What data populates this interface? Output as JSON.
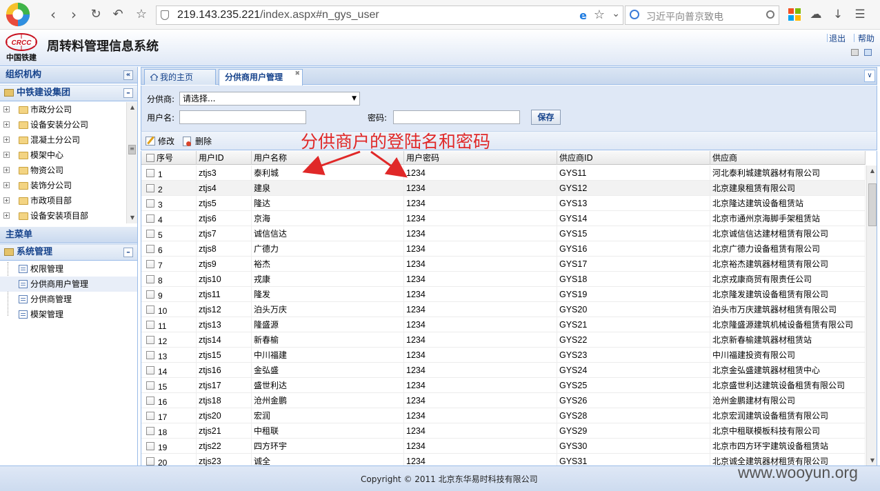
{
  "browser": {
    "url_host": "219.143.235.221",
    "url_path": "/index.aspx#n_gys_user",
    "search_placeholder": "习近平向普京致电"
  },
  "app": {
    "title": "周转料管理信息系统",
    "logo_text": "中国铁建",
    "logo_mark": "CRCC",
    "links": {
      "logout": "退出",
      "help": "帮助"
    }
  },
  "left": {
    "org_title": "组织机构",
    "org_group": "中铁建设集团",
    "org_items": [
      "市政分公司",
      "设备安装分公司",
      "混凝土分公司",
      "模架中心",
      "物资公司",
      "装饰分公司",
      "市政项目部",
      "设备安装项目部"
    ],
    "menu_title": "主菜单",
    "menu_group": "系统管理",
    "menu_items": [
      "权限管理",
      "分供商用户管理",
      "分供商管理",
      "模架管理"
    ]
  },
  "tabs": [
    "我的主页",
    "分供商用户管理"
  ],
  "form": {
    "supplier_label": "分供商:",
    "supplier_value": "请选择...",
    "username_label": "用户名:",
    "password_label": "密码:",
    "save_label": "保存"
  },
  "toolbar": {
    "edit_label": "修改",
    "delete_label": "删除"
  },
  "grid": {
    "columns": [
      "序号",
      "用户ID",
      "用户名称",
      "用户密码",
      "供应商ID",
      "供应商"
    ],
    "rows": [
      [
        "1",
        "ztjs3",
        "泰利城",
        "1234",
        "GYS11",
        "河北泰利城建筑器材有限公司"
      ],
      [
        "2",
        "ztjs4",
        "建泉",
        "1234",
        "GYS12",
        "北京建泉租赁有限公司"
      ],
      [
        "3",
        "ztjs5",
        "隆达",
        "1234",
        "GYS13",
        "北京隆达建筑设备租赁站"
      ],
      [
        "4",
        "ztjs6",
        "京海",
        "1234",
        "GYS14",
        "北京市通州京海脚手架租赁站"
      ],
      [
        "5",
        "ztjs7",
        "诚信信达",
        "1234",
        "GYS15",
        "北京诚信信达建材租赁有限公司"
      ],
      [
        "6",
        "ztjs8",
        "广德力",
        "1234",
        "GYS16",
        "北京广德力设备租赁有限公司"
      ],
      [
        "7",
        "ztjs9",
        "裕杰",
        "1234",
        "GYS17",
        "北京裕杰建筑器材租赁有限公司"
      ],
      [
        "8",
        "ztjs10",
        "戎康",
        "1234",
        "GYS18",
        "北京戎康商贸有限责任公司"
      ],
      [
        "9",
        "ztjs11",
        "隆发",
        "1234",
        "GYS19",
        "北京隆发建筑设备租赁有限公司"
      ],
      [
        "10",
        "ztjs12",
        "泊头万庆",
        "1234",
        "GYS20",
        "泊头市万庆建筑器材租赁有限公司"
      ],
      [
        "11",
        "ztjs13",
        "隆盛源",
        "1234",
        "GYS21",
        "北京隆盛源建筑机械设备租赁有限公司"
      ],
      [
        "12",
        "ztjs14",
        "新春榆",
        "1234",
        "GYS22",
        "北京新春榆建筑器材租赁站"
      ],
      [
        "13",
        "ztjs15",
        "中川福建",
        "1234",
        "GYS23",
        "中川福建投资有限公司"
      ],
      [
        "14",
        "ztjs16",
        "金弘盛",
        "1234",
        "GYS24",
        "北京金弘盛建筑器材租赁中心"
      ],
      [
        "15",
        "ztjs17",
        "盛世利达",
        "1234",
        "GYS25",
        "北京盛世利达建筑设备租赁有限公司"
      ],
      [
        "16",
        "ztjs18",
        "沧州金鹏",
        "1234",
        "GYS26",
        "沧州金鹏建材有限公司"
      ],
      [
        "17",
        "ztjs20",
        "宏润",
        "1234",
        "GYS28",
        "北京宏润建筑设备租赁有限公司"
      ],
      [
        "18",
        "ztjs21",
        "中租联",
        "1234",
        "GYS29",
        "北京中租联模板科技有限公司"
      ],
      [
        "19",
        "ztjs22",
        "四方环宇",
        "1234",
        "GYS30",
        "北京市四方环宇建筑设备租赁站"
      ],
      [
        "20",
        "ztjs23",
        "诚全",
        "1234",
        "GYS31",
        "北京诚全建筑器材租赁有限公司"
      ]
    ]
  },
  "annotation": "分供商户的登陆名和密码",
  "footer": "Copyright © 2011 北京东华易时科技有限公司",
  "watermark": "www.wooyun.org",
  "colors": {
    "accent": "#15428b",
    "panel_border": "#99bbe8",
    "annotation": "#e02828"
  }
}
